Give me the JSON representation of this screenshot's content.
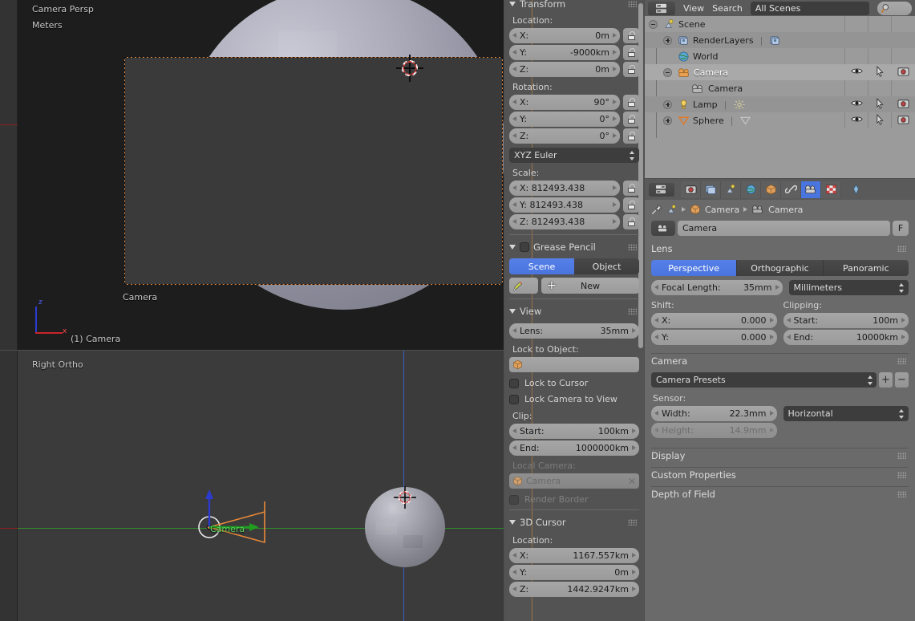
{
  "viewport_top": {
    "view_name": "Camera Persp",
    "unit_label": "Meters",
    "camera_label": "Camera",
    "marker_label": "(1) Camera",
    "axis_z": "z",
    "axis_x": "x"
  },
  "viewport_bottom": {
    "view_name": "Right Ortho",
    "camera_label": "Camera"
  },
  "sidebar": {
    "transform": {
      "title": "Transform",
      "location_label": "Location:",
      "location": [
        {
          "label": "X:",
          "value": "0m"
        },
        {
          "label": "Y:",
          "value": "-9000km"
        },
        {
          "label": "Z:",
          "value": "0m"
        }
      ],
      "rotation_label": "Rotation:",
      "rotation": [
        {
          "label": "X:",
          "value": "90°"
        },
        {
          "label": "Y:",
          "value": "0°"
        },
        {
          "label": "Z:",
          "value": "0°"
        }
      ],
      "rotation_mode": "XYZ Euler",
      "scale_label": "Scale:",
      "scale": [
        {
          "label": "X: 812493.438",
          "value": ""
        },
        {
          "label": "Y: 812493.438",
          "value": ""
        },
        {
          "label": "Z: 812493.438",
          "value": ""
        }
      ]
    },
    "grease_pencil": {
      "title": "Grease Pencil",
      "scene_btn": "Scene",
      "object_btn": "Object",
      "new_btn": "New"
    },
    "view": {
      "title": "View",
      "lens_label": "Lens:",
      "lens_value": "35mm",
      "lock_to_object_label": "Lock to Object:",
      "lock_to_object_value": "",
      "lock_to_cursor": "Lock to Cursor",
      "lock_camera_to_view": "Lock Camera to View",
      "clip_label": "Clip:",
      "clip_start_label": "Start:",
      "clip_start_value": "100km",
      "clip_end_label": "End:",
      "clip_end_value": "1000000km",
      "local_camera_label": "Local Camera:",
      "local_camera_value": "Camera",
      "render_border": "Render Border"
    },
    "cursor3d": {
      "title": "3D Cursor",
      "location_label": "Location:",
      "location": [
        {
          "label": "X:",
          "value": "1167.557km"
        },
        {
          "label": "Y:",
          "value": "0m"
        },
        {
          "label": "Z:",
          "value": "1442.9247km"
        }
      ]
    }
  },
  "outliner": {
    "menu_view": "View",
    "menu_search": "Search",
    "scene_filter": "All Scenes",
    "search_value": "",
    "rows": [
      {
        "label": "Scene",
        "indent": 0,
        "icon": "scene-icon",
        "expander": "minus",
        "selected": false,
        "icons": false
      },
      {
        "label": "RenderLayers",
        "indent": 1,
        "icon": "renderlayers-icon",
        "expander": "plus",
        "selected": false,
        "icons": false,
        "extra": "renderlayer-data-icon"
      },
      {
        "label": "World",
        "indent": 1,
        "icon": "world-icon",
        "expander": "none",
        "selected": false,
        "icons": false
      },
      {
        "label": "Camera",
        "indent": 1,
        "icon": "camera-object-icon",
        "expander": "minus",
        "selected": true,
        "icons": true
      },
      {
        "label": "Camera",
        "indent": 2,
        "icon": "camera-data-icon",
        "expander": "none",
        "selected": false,
        "icons": false
      },
      {
        "label": "Lamp",
        "indent": 1,
        "icon": "lamp-icon",
        "expander": "plus",
        "selected": false,
        "icons": true,
        "extra": "lamp-data-icon"
      },
      {
        "label": "Sphere",
        "indent": 1,
        "icon": "mesh-icon",
        "expander": "plus",
        "selected": false,
        "icons": true,
        "extra": "mesh-data-icon"
      }
    ]
  },
  "properties": {
    "tabs": [
      {
        "name": "render-tab",
        "active": false
      },
      {
        "name": "render-layers-tab",
        "active": false
      },
      {
        "name": "scene-tab",
        "active": false
      },
      {
        "name": "world-tab",
        "active": false
      },
      {
        "name": "object-tab",
        "active": false
      },
      {
        "name": "constraints-tab",
        "active": false
      },
      {
        "name": "object-data-tab",
        "active": true
      },
      {
        "name": "texture-tab",
        "active": false
      }
    ],
    "breadcrumb": [
      "Camera",
      "Camera"
    ],
    "datablock_name": "Camera",
    "f_button": "F",
    "lens": {
      "title": "Lens",
      "type_perspective": "Perspective",
      "type_orthographic": "Orthographic",
      "type_panoramic": "Panoramic",
      "focal_length_label": "Focal Length:",
      "focal_length_value": "35mm",
      "focal_unit": "Millimeters",
      "shift_label": "Shift:",
      "shift_x_label": "X:",
      "shift_x_value": "0.000",
      "shift_y_label": "Y:",
      "shift_y_value": "0.000",
      "clipping_label": "Clipping:",
      "clip_start_label": "Start:",
      "clip_start_value": "100m",
      "clip_end_label": "End:",
      "clip_end_value": "10000km"
    },
    "camera": {
      "title": "Camera",
      "presets": "Camera Presets",
      "add_preset": "+",
      "remove_preset": "−",
      "sensor_label": "Sensor:",
      "width_label": "Width:",
      "width_value": "22.3mm",
      "height_label": "Height:",
      "height_value": "14.9mm",
      "fit": "Horizontal"
    },
    "collapsed": [
      {
        "title": "Display"
      },
      {
        "title": "Custom Properties"
      },
      {
        "title": "Depth of Field"
      }
    ]
  },
  "colors": {
    "accent_blue": "#4a74de",
    "camera_orange": "#e8893a",
    "grid_green": "#2f8a2f",
    "axis_blue": "#2b3bd0",
    "axis_red": "#c8252a"
  }
}
